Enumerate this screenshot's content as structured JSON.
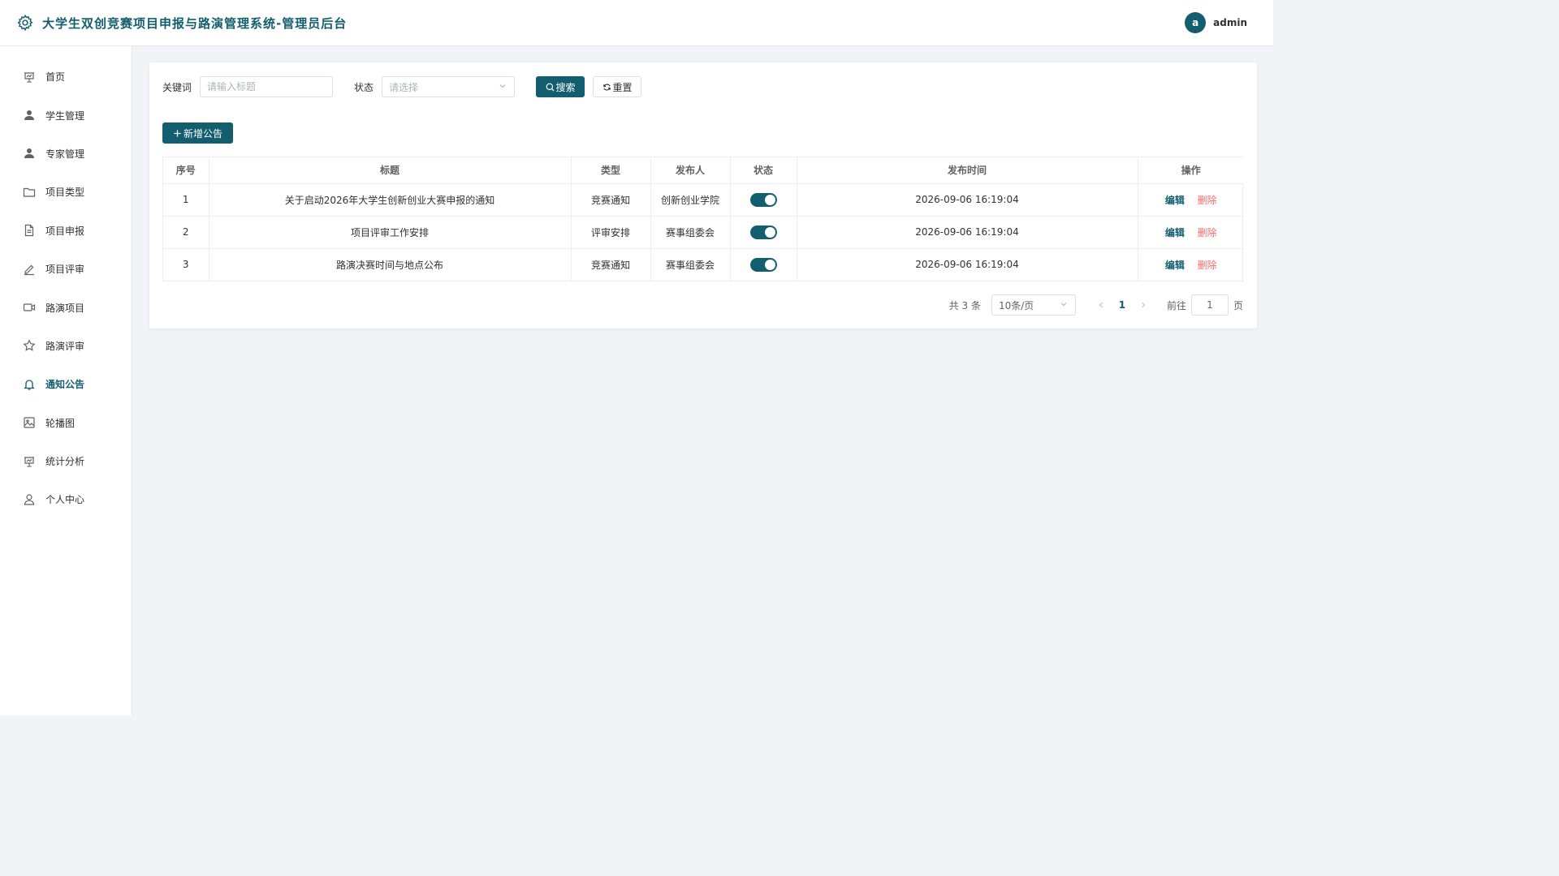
{
  "header": {
    "title": "大学生双创竞赛项目申报与路演管理系统-管理员后台",
    "avatar_letter": "a",
    "username": "admin",
    "brand_color": "#135e6e"
  },
  "sidebar": {
    "items": [
      {
        "label": "首页",
        "icon": "presentation-icon"
      },
      {
        "label": "学生管理",
        "icon": "user-filled-icon"
      },
      {
        "label": "专家管理",
        "icon": "user-filled-icon"
      },
      {
        "label": "项目类型",
        "icon": "folder-icon"
      },
      {
        "label": "项目申报",
        "icon": "document-icon"
      },
      {
        "label": "项目评审",
        "icon": "edit-pen-icon"
      },
      {
        "label": "路演项目",
        "icon": "video-camera-icon"
      },
      {
        "label": "路演评审",
        "icon": "star-icon"
      },
      {
        "label": "通知公告",
        "icon": "bell-icon",
        "active": true
      },
      {
        "label": "轮播图",
        "icon": "picture-icon"
      },
      {
        "label": "统计分析",
        "icon": "presentation-icon"
      },
      {
        "label": "个人中心",
        "icon": "user-icon"
      }
    ]
  },
  "filters": {
    "keyword_label": "关键词",
    "keyword_placeholder": "请输入标题",
    "keyword_value": "",
    "status_label": "状态",
    "status_placeholder": "请选择",
    "search_label": "搜索",
    "reset_label": "重置"
  },
  "toolbar": {
    "add_label": "新增公告"
  },
  "table": {
    "columns": [
      "序号",
      "标题",
      "类型",
      "发布人",
      "状态",
      "发布时间",
      "操作"
    ],
    "rows": [
      {
        "index": "1",
        "title": "关于启动2026年大学生创新创业大赛申报的通知",
        "type": "竞赛通知",
        "publisher": "创新创业学院",
        "status_on": true,
        "time": "2026-09-06 16:19:04"
      },
      {
        "index": "2",
        "title": "项目评审工作安排",
        "type": "评审安排",
        "publisher": "赛事组委会",
        "status_on": true,
        "time": "2026-09-06 16:19:04"
      },
      {
        "index": "3",
        "title": "路演决赛时间与地点公布",
        "type": "竞赛通知",
        "publisher": "赛事组委会",
        "status_on": true,
        "time": "2026-09-06 16:19:04"
      }
    ],
    "edit_label": "编辑",
    "delete_label": "删除"
  },
  "pagination": {
    "total_text": "共 3 条",
    "page_size": "10条/页",
    "current_page": "1",
    "goto_label": "前往",
    "goto_value": "1",
    "page_unit": "页"
  }
}
